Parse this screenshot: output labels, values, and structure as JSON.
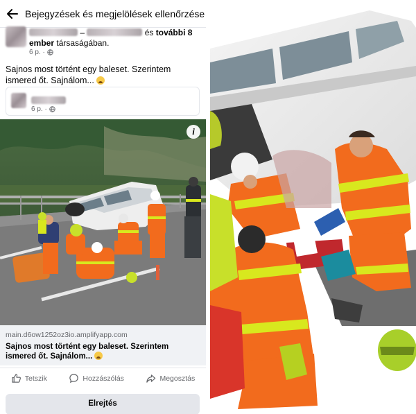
{
  "header": {
    "title": "Bejegyzések és megjelölések ellenőrzése"
  },
  "post": {
    "separator": "–",
    "and_text": "és",
    "others": "további 8 ember",
    "company": "társaságában.",
    "time": "6 p. ·",
    "text": "Sajnos most történt egy baleset. Szerintem ismered őt. Sajnálom...",
    "info": "i"
  },
  "comment": {
    "time": "6 p. ·"
  },
  "link": {
    "domain": "main.d6ow1252oz3io.amplifyapp.com",
    "title": "Sajnos most történt egy baleset. Szerintem ismered őt. Sajnálom..."
  },
  "actions": {
    "like": "Tetszik",
    "comment": "Hozzászólás",
    "share": "Megosztás"
  },
  "hide_button": "Elrejtés",
  "colors": {
    "accent": "#1877f2",
    "text": "#050505",
    "secondary": "#65676b",
    "divider": "#e4e6eb",
    "rescue_orange": "#f26b1d",
    "hivis_yellow": "#d8e81e"
  }
}
